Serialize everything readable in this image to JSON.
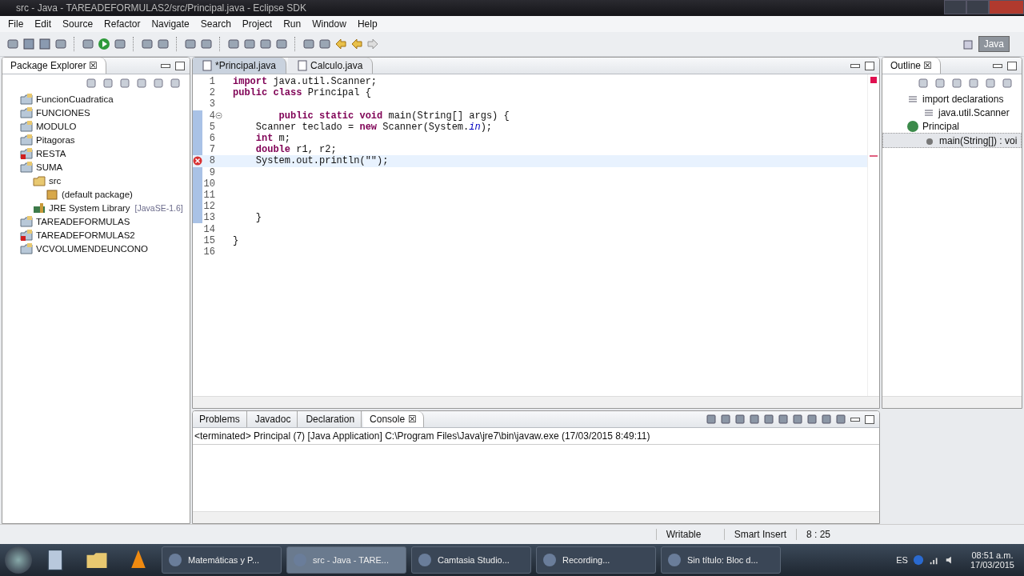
{
  "window": {
    "title": "src - Java - TAREADEFORMULAS2/src/Principal.java - Eclipse SDK"
  },
  "menu": [
    "File",
    "Edit",
    "Source",
    "Refactor",
    "Navigate",
    "Search",
    "Project",
    "Run",
    "Window",
    "Help"
  ],
  "perspective": {
    "label": "Java",
    "selected": true
  },
  "package_explorer": {
    "title": "Package Explorer",
    "close": "☒",
    "items": [
      {
        "label": "FuncionCuadratica",
        "kind": "project",
        "error": false
      },
      {
        "label": "FUNCIONES",
        "kind": "project",
        "error": false
      },
      {
        "label": "MODULO",
        "kind": "project",
        "error": false
      },
      {
        "label": "Pitagoras",
        "kind": "project",
        "error": false
      },
      {
        "label": "RESTA",
        "kind": "project",
        "error": true
      },
      {
        "label": "SUMA",
        "kind": "project",
        "error": false,
        "children": [
          {
            "label": "src",
            "kind": "folder",
            "error": false,
            "children": [
              {
                "label": "(default package)",
                "kind": "package",
                "error": false
              }
            ]
          },
          {
            "label": "JRE System Library",
            "suffix": "[JavaSE-1.6]",
            "kind": "library",
            "error": false
          }
        ]
      },
      {
        "label": "TAREADEFORMULAS",
        "kind": "project",
        "error": false
      },
      {
        "label": "TAREADEFORMULAS2",
        "kind": "project",
        "error": true
      },
      {
        "label": "VCVOLUMENDEUNCONO",
        "kind": "project",
        "error": false
      }
    ]
  },
  "editor": {
    "tabs": [
      {
        "label": "*Principal.java",
        "selected": true
      },
      {
        "label": "Calculo.java",
        "selected": false
      }
    ],
    "lines": [
      {
        "number": "1",
        "text": "**import** java.util.Scanner;",
        "error": false,
        "current": false,
        "changed": false,
        "fold": false
      },
      {
        "number": "2",
        "text": "**public** **class** Principal {",
        "error": false,
        "current": false,
        "changed": false,
        "fold": false
      },
      {
        "number": "3",
        "error": false,
        "current": false,
        "changed": false,
        "fold": false
      },
      {
        "number": "4",
        "text": "        **public** **static** **void** main(String[] args) {",
        "error": false,
        "current": false,
        "changed": true,
        "fold": true
      },
      {
        "number": "5",
        "text": "    Scanner teclado = **new** Scanner(System.*in*);",
        "error": false,
        "current": false,
        "changed": true,
        "fold": false
      },
      {
        "number": "6",
        "text": "    **int** m;",
        "error": false,
        "current": false,
        "changed": true,
        "fold": false
      },
      {
        "number": "7",
        "text": "    **double** r1, r2;",
        "error": false,
        "current": false,
        "changed": true,
        "fold": false
      },
      {
        "number": "8",
        "text": "    System.out.println(\"\");",
        "error": true,
        "current": true,
        "changed": true,
        "fold": false
      },
      {
        "number": "9",
        "error": false,
        "current": false,
        "changed": true,
        "fold": false
      },
      {
        "number": "10",
        "error": false,
        "current": false,
        "changed": true,
        "fold": false
      },
      {
        "number": "11",
        "error": false,
        "current": false,
        "changed": true,
        "fold": false
      },
      {
        "number": "12",
        "error": false,
        "current": false,
        "changed": true,
        "fold": false
      },
      {
        "number": "13",
        "text": "    }",
        "error": false,
        "current": false,
        "changed": true,
        "fold": false
      },
      {
        "number": "14",
        "error": false,
        "current": false,
        "changed": false,
        "fold": false
      },
      {
        "number": "15",
        "text": "}",
        "error": false,
        "current": false,
        "changed": false,
        "fold": false
      },
      {
        "number": "16",
        "error": false,
        "current": false,
        "changed": false,
        "fold": false
      }
    ]
  },
  "outline": {
    "title": "Outline",
    "close": "☒",
    "items": [
      {
        "label": "import declarations",
        "kind": "imports",
        "selected": false,
        "children": [
          {
            "label": "java.util.Scanner",
            "kind": "import",
            "selected": false
          }
        ]
      },
      {
        "label": "Principal",
        "kind": "class",
        "selected": false,
        "children": [
          {
            "label": "main(String[]) : voi",
            "kind": "method",
            "selected": true
          }
        ]
      }
    ]
  },
  "bottom": {
    "tabs": [
      {
        "label": "Problems",
        "selected": false
      },
      {
        "label": "Javadoc",
        "selected": false
      },
      {
        "label": "Declaration",
        "selected": false
      },
      {
        "label": "Console",
        "selected": true
      }
    ],
    "close": "☒",
    "console_header": "<terminated> Principal (7) [Java Application] C:\\Program Files\\Java\\jre7\\bin\\javaw.exe (17/03/2015 8:49:11)"
  },
  "status_bar": [
    "Writable",
    "Smart Insert",
    "8 : 25"
  ],
  "taskbar": {
    "buttons": [
      {
        "label": "Matemáticas y P...",
        "selected": false
      },
      {
        "label": "src - Java - TARE...",
        "selected": true
      },
      {
        "label": "Camtasia Studio...",
        "selected": false
      },
      {
        "label": "Recording...",
        "selected": false
      },
      {
        "label": "Sin título: Bloc d...",
        "selected": false
      }
    ],
    "language": "ES",
    "time": "08:51 a.m.",
    "date": "17/03/2015"
  }
}
